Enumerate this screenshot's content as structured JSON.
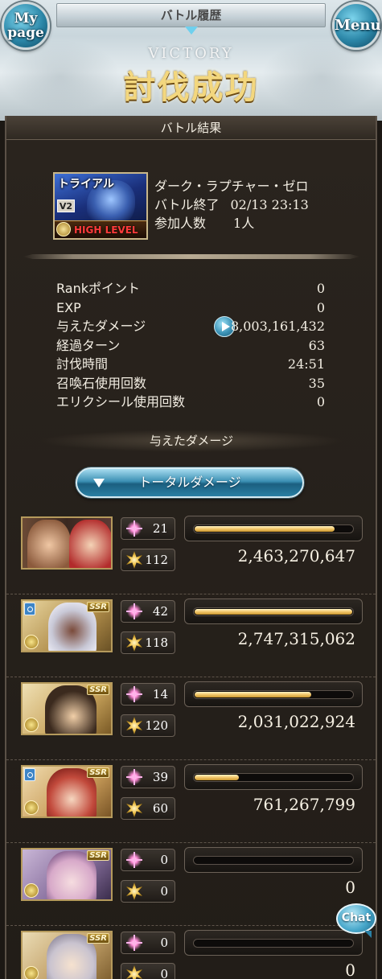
{
  "header": {
    "title": "バトル履歴",
    "mypage_label_line1": "My",
    "mypage_label_line2": "page",
    "menu_label": "Menu",
    "victory_label": "VICTORY",
    "result_heading": "討伐成功"
  },
  "panel": {
    "title": "バトル結果"
  },
  "quest": {
    "badge_label": "トライアル",
    "version_label": "V2",
    "difficulty_label": "HIGH LEVEL",
    "name": "ダーク・ラプチャー・ゼロ",
    "end_label": "バトル終了",
    "end_value": "02/13 23:13",
    "participants_label": "参加人数",
    "participants_value": "1人"
  },
  "stats": [
    {
      "label": "Rankポイント",
      "value": "0"
    },
    {
      "label": "EXP",
      "value": "0"
    },
    {
      "label": "与えたダメージ",
      "value": "8,003,161,432"
    },
    {
      "label": "経過ターン",
      "value": "63"
    },
    {
      "label": "討伐時間",
      "value": "24:51"
    },
    {
      "label": "召喚石使用回数",
      "value": "35"
    },
    {
      "label": "エリクシール使用回数",
      "value": "0"
    }
  ],
  "damage_section": {
    "heading": "与えたダメージ",
    "total_button_label": "トータルダメージ"
  },
  "characters": [
    {
      "ability_count": "21",
      "ca_count": "112",
      "damage": "2,463,270,647",
      "gauge_fill": 0.89,
      "portrait": "main-character-pair"
    },
    {
      "ability_count": "42",
      "ca_count": "118",
      "damage": "2,747,315,062",
      "gauge_fill": 1.0,
      "portrait": "ssr-water-character"
    },
    {
      "ability_count": "14",
      "ca_count": "120",
      "damage": "2,031,022,924",
      "gauge_fill": 0.74,
      "portrait": "ssr-character"
    },
    {
      "ability_count": "39",
      "ca_count": "60",
      "damage": "761,267,799",
      "gauge_fill": 0.28,
      "portrait": "ssr-water-character"
    },
    {
      "ability_count": "0",
      "ca_count": "0",
      "damage": "0",
      "gauge_fill": 0.0,
      "portrait": "ssr-character"
    },
    {
      "ability_count": "0",
      "ca_count": "0",
      "damage": "0",
      "gauge_fill": 0.0,
      "portrait": "ssr-character"
    }
  ],
  "ssr_badge": "SSR",
  "chat_label": "Chat",
  "colors": {
    "accent_blue": "#3c90b4",
    "gold": "#f2c76a",
    "panel_bg": "#221d18"
  }
}
